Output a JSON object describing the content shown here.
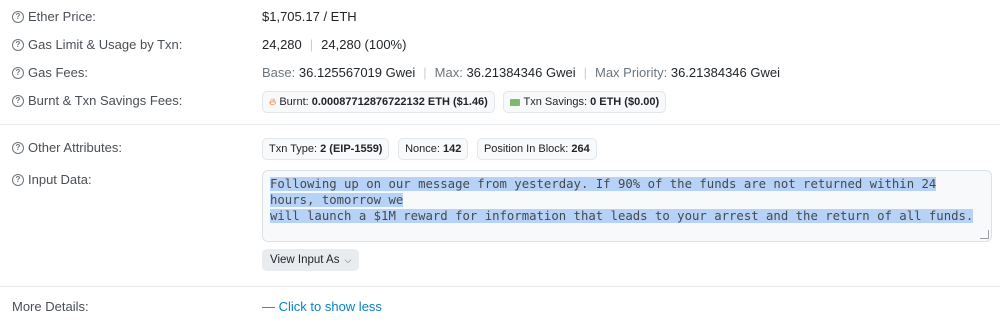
{
  "ether_price": {
    "label": "Ether Price:",
    "value": "$1,705.17 / ETH"
  },
  "gas_limit": {
    "label": "Gas Limit & Usage by Txn:",
    "limit": "24,280",
    "usage": "24,280 (100%)"
  },
  "gas_fees": {
    "label": "Gas Fees:",
    "base_label": "Base:",
    "base_value": "36.125567019 Gwei",
    "max_label": "Max:",
    "max_value": "36.21384346 Gwei",
    "max_priority_label": "Max Priority:",
    "max_priority_value": "36.21384346 Gwei"
  },
  "burnt_savings": {
    "label": "Burnt & Txn Savings Fees:",
    "burnt_label": "Burnt:",
    "burnt_value": "0.00087712876722132 ETH ($1.46)",
    "savings_label": "Txn Savings:",
    "savings_value": "0 ETH ($0.00)"
  },
  "other_attributes": {
    "label": "Other Attributes:",
    "txn_type_label": "Txn Type:",
    "txn_type_value": "2 (EIP-1559)",
    "nonce_label": "Nonce:",
    "nonce_value": "142",
    "position_label": "Position In Block:",
    "position_value": "264"
  },
  "input_data": {
    "label": "Input Data:",
    "line1": "Following up on our message from yesterday. If 90% of the funds are not returned within 24 hours, tomorrow we",
    "line2": "will launch a $1M reward for information that leads to your arrest and the return of all funds.",
    "view_button": "View Input As"
  },
  "more_details": {
    "label": "More Details:",
    "link": "— Click to show less"
  },
  "icons": {
    "help": "help-circle-icon",
    "fire": "fire-icon",
    "savings": "money-icon",
    "chevron": "chevron-down-icon"
  }
}
